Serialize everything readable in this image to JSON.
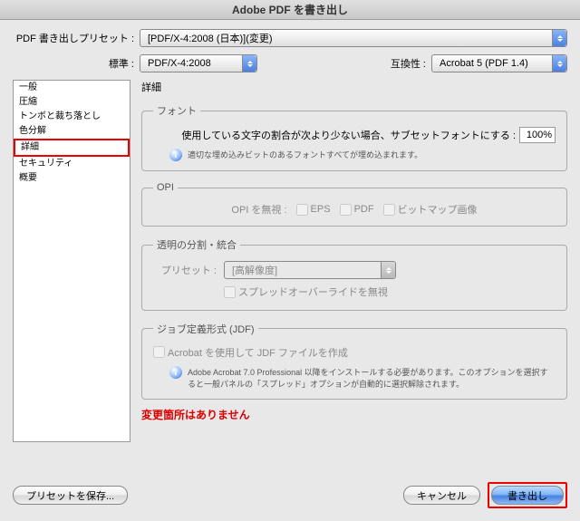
{
  "title": "Adobe PDF を書き出し",
  "preset": {
    "label": "PDF 書き出しプリセット :",
    "value": "[PDF/X-4:2008 (日本)](変更)"
  },
  "standard": {
    "label": "標準 :",
    "value": "PDF/X-4:2008"
  },
  "compat": {
    "label": "互換性 :",
    "value": "Acrobat 5 (PDF 1.4)"
  },
  "sidebar": {
    "items": [
      {
        "label": "一般"
      },
      {
        "label": "圧縮"
      },
      {
        "label": "トンボと裁ち落とし"
      },
      {
        "label": "色分解"
      },
      {
        "label": "詳細",
        "selected": true
      },
      {
        "label": "セキュリティ"
      },
      {
        "label": "概要"
      }
    ]
  },
  "panel_title": "詳細",
  "font": {
    "legend": "フォント",
    "label": "使用している文字の割合が次より少ない場合、サブセットフォントにする :",
    "value": "100%",
    "note": "適切な埋め込みビットのあるフォントすべてが埋め込まれます。"
  },
  "opi": {
    "legend": "OPI",
    "label": "OPI を無視 :",
    "eps": "EPS",
    "pdf": "PDF",
    "bitmap": "ビットマップ画像"
  },
  "transparency": {
    "legend": "透明の分割・統合",
    "preset_label": "プリセット :",
    "preset_value": "[高解像度]",
    "spread": "スプレッドオーバーライドを無視"
  },
  "jdf": {
    "legend": "ジョブ定義形式 (JDF)",
    "checkbox": "Acrobat を使用して JDF ファイルを作成",
    "note": "Adobe Acrobat 7.0 Professional 以降をインストールする必要があります。このオプションを選択すると一般パネルの「スプレッド」オプションが自動的に選択解除されます。"
  },
  "notice": "変更箇所はありません",
  "buttons": {
    "save_preset": "プリセットを保存...",
    "cancel": "キャンセル",
    "export": "書き出し"
  }
}
